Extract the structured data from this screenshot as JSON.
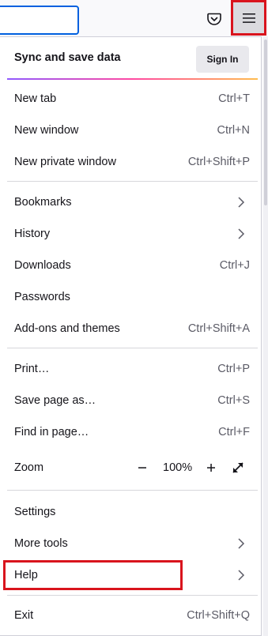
{
  "toolbar": {
    "urlbar_value": "",
    "pocket_icon": "pocket-icon",
    "menu_icon": "hamburger-icon"
  },
  "sync": {
    "label": "Sync and save data",
    "signin_label": "Sign In"
  },
  "groups": [
    [
      {
        "label": "New tab",
        "shortcut": "Ctrl+T"
      },
      {
        "label": "New window",
        "shortcut": "Ctrl+N"
      },
      {
        "label": "New private window",
        "shortcut": "Ctrl+Shift+P"
      }
    ],
    [
      {
        "label": "Bookmarks",
        "submenu": true
      },
      {
        "label": "History",
        "submenu": true
      },
      {
        "label": "Downloads",
        "shortcut": "Ctrl+J"
      },
      {
        "label": "Passwords"
      },
      {
        "label": "Add-ons and themes",
        "shortcut": "Ctrl+Shift+A"
      }
    ],
    [
      {
        "label": "Print…",
        "shortcut": "Ctrl+P"
      },
      {
        "label": "Save page as…",
        "shortcut": "Ctrl+S"
      },
      {
        "label": "Find in page…",
        "shortcut": "Ctrl+F"
      }
    ],
    [
      {
        "label": "Settings"
      },
      {
        "label": "More tools",
        "submenu": true
      },
      {
        "label": "Help",
        "submenu": true
      }
    ],
    [
      {
        "label": "Exit",
        "shortcut": "Ctrl+Shift+Q"
      }
    ]
  ],
  "zoom": {
    "label": "Zoom",
    "value": "100%"
  },
  "colors": {
    "highlight": "#d9141d",
    "accent": "#0060df"
  }
}
